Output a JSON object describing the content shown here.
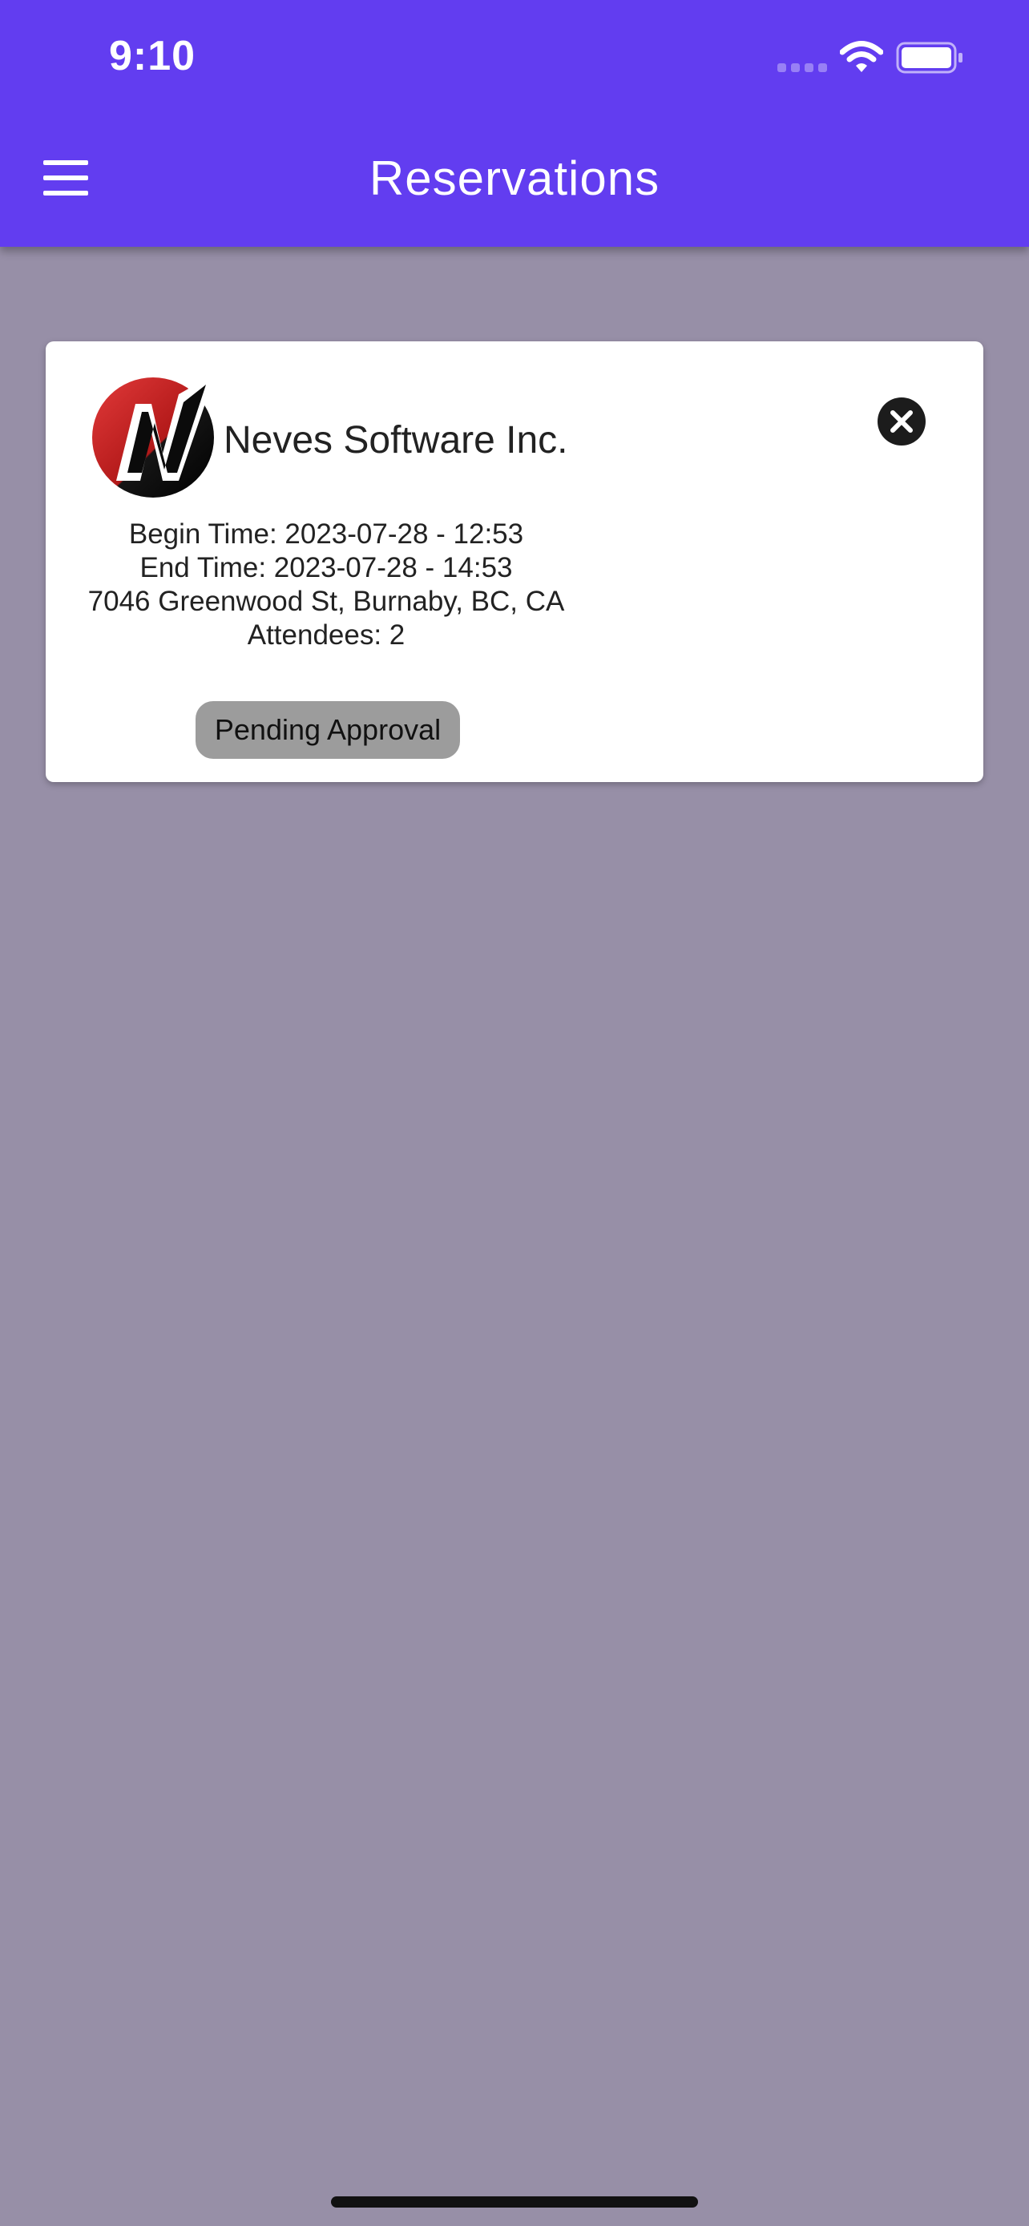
{
  "status_bar": {
    "time": "9:10",
    "signal_icon": "cellular-signal-icon",
    "wifi_icon": "wifi-icon",
    "battery_icon": "battery-icon"
  },
  "app_bar": {
    "menu_icon": "hamburger-menu-icon",
    "title": "Reservations"
  },
  "reservations": [
    {
      "company_name": "Neves Software Inc.",
      "logo_icon": "company-logo-n",
      "begin_time": "Begin Time: 2023-07-28 - 12:53",
      "end_time": "End Time: 2023-07-28 - 14:53",
      "address": "7046 Greenwood St, Burnaby, BC, CA",
      "attendees": "Attendees: 2",
      "status": "Pending Approval",
      "close_icon": "close-circle-icon"
    }
  ],
  "colors": {
    "app_bar": "#623df0",
    "background": "#978fa7",
    "card": "#ffffff",
    "status_badge": "#9c9c9c"
  }
}
